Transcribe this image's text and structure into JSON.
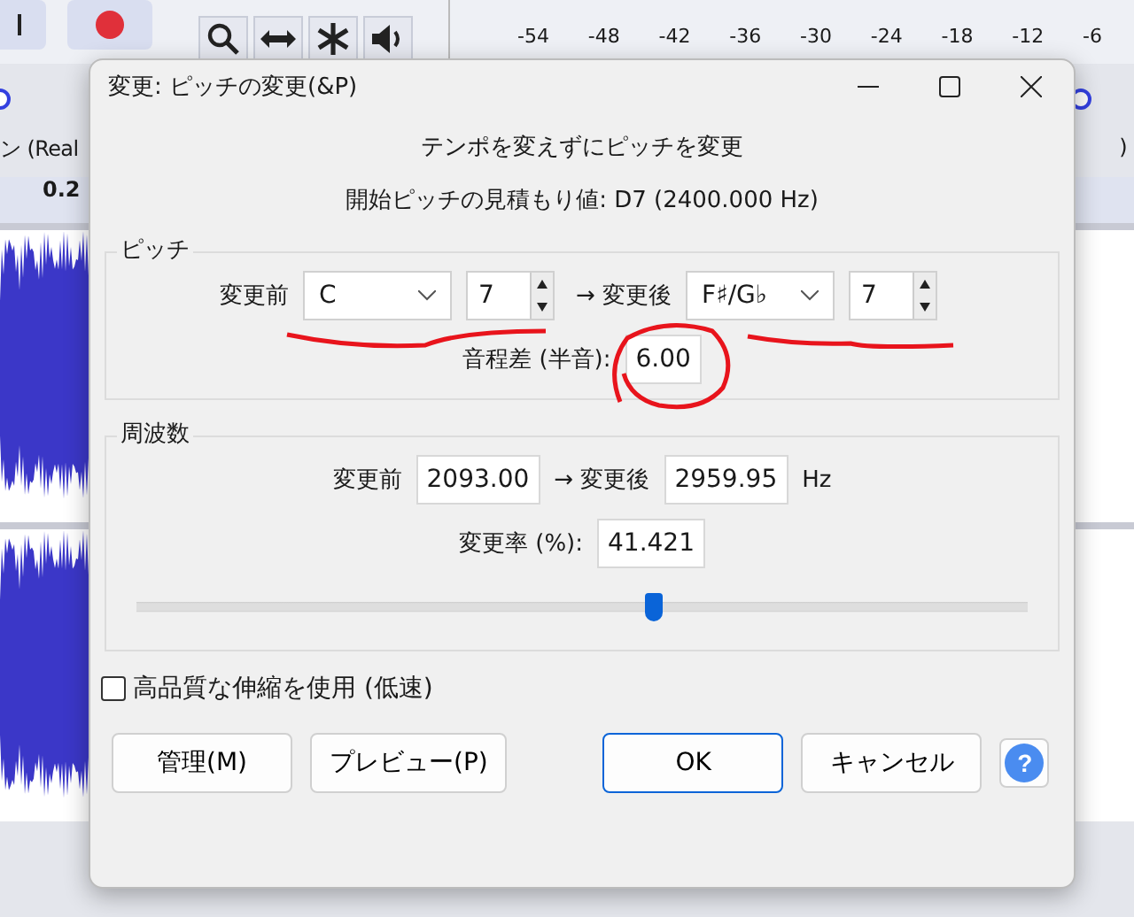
{
  "app": {
    "meter_ticks": [
      "-54",
      "-48",
      "-42",
      "-36",
      "-30",
      "-24",
      "-18",
      "-12",
      "-6"
    ],
    "track_name": "ン (Real",
    "track_name_end": ")",
    "ruler_label": "0.2"
  },
  "dialog": {
    "title": "変更: ピッチの変更(&P)",
    "heading": "テンポを変えずにピッチを変更",
    "estimate": "開始ピッチの見積もり値: D7 (2400.000 Hz)",
    "pitch": {
      "label": "ピッチ",
      "from_label": "変更前",
      "from_note": "C",
      "from_octave": "7",
      "to_label": "→ 変更後",
      "to_note": "F♯/G♭",
      "to_octave": "7",
      "semitones_label": "音程差 (半音):",
      "semitones": "6.00"
    },
    "frequency": {
      "label": "周波数",
      "from_label": "変更前",
      "from_hz": "2093.00",
      "to_label": "→ 変更後",
      "to_hz": "2959.95",
      "unit": "Hz",
      "percent_label": "変更率 (%):",
      "percent": "41.421",
      "level": 0.58
    },
    "high_quality": {
      "label": "高品質な伸縮を使用 (低速)",
      "checked": false
    },
    "buttons": [
      {
        "label": "管理(M)",
        "default": false
      },
      {
        "label": "プレビュー(P)",
        "default": false
      },
      {
        "label": "OK",
        "default": true
      },
      {
        "label": "キャンセル",
        "default": false
      }
    ],
    "help": "?"
  }
}
